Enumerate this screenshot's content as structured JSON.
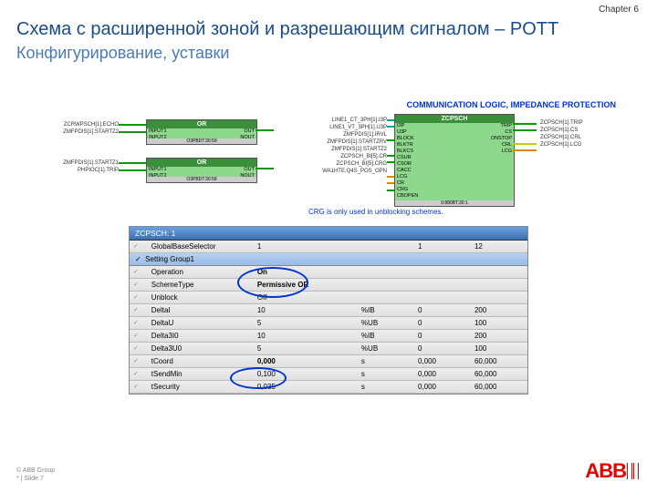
{
  "chapter": "Chapter 6",
  "title1": "Схема с расширенной зоной и разрешающим сигналом – POTT",
  "title2": "Конфигурирование, уставки",
  "diagram_title": "COMMUNICATION LOGIC, IMPEDANCE PROTECTION",
  "or": {
    "header": "OR",
    "in1": "INPUT1",
    "in2": "INPUT2",
    "out": "OUT",
    "nout": "NOUT",
    "foot1": "O3PBDT:30:59",
    "foot2": "O3PBDT:30:58"
  },
  "leftTerms1": [
    "ZCRWPSCH[1].ECHO",
    "ZMFPDIS[1].STARTZ2"
  ],
  "leftTerms2": [
    "ZMFPDIS[1].STARTZ1",
    "PHPIOC[1].TRIP"
  ],
  "midTerms": [
    "LINE1_CT_3PH[1].I3P",
    "LINE1_VT_3PH[1].U3P",
    "",
    "ZMFPDIS[1].IRVL",
    "",
    "ZMFPDIS[1].STARTZRV",
    "ZMFPDIS[1].STARTZ2",
    "",
    "ZCPSCH_BI[5].CR",
    "ZCPSCH_BI[5].CRG",
    "WA1HTE.Q4S_POS_OPN"
  ],
  "main": {
    "header": "ZCPSCH",
    "foot": "0:880BT:30:1",
    "leftPorts": [
      "I3P",
      "U3P",
      "BLOCK",
      "BLKTR",
      "BLKCS",
      "CSUR",
      "CSOR",
      "CACC",
      "LCG",
      "CR",
      "CRG",
      "CBOPEN"
    ],
    "rightPorts": [
      "TRIP",
      "CS",
      "ONSTOP",
      "CRL",
      "LCG"
    ]
  },
  "rightTerms": [
    "ZCPSCH[1].TRIP",
    "ZCPSCH[1].CS",
    "",
    "ZCPSCH[1].CRL",
    "ZCPSCH[1].LCG"
  ],
  "note": "CRG is only used in unblocking schemes.",
  "table": {
    "header": "ZCPSCH: 1",
    "row1": {
      "name": "GlobalBaseSelector",
      "val": "1",
      "unit": "",
      "min": "1",
      "max": "12"
    },
    "section": "Setting Group1",
    "rows": [
      {
        "name": "Operation",
        "val": "On",
        "unit": "",
        "min": "",
        "max": ""
      },
      {
        "name": "SchemeType",
        "val": "Permissive OR",
        "unit": "",
        "min": "",
        "max": ""
      },
      {
        "name": "Unblock",
        "val": "Off",
        "unit": "",
        "min": "",
        "max": ""
      },
      {
        "name": "DeltaI",
        "val": "10",
        "unit": "%IB",
        "min": "0",
        "max": "200"
      },
      {
        "name": "DeltaU",
        "val": "5",
        "unit": "%UB",
        "min": "0",
        "max": "100"
      },
      {
        "name": "Delta3I0",
        "val": "10",
        "unit": "%IB",
        "min": "0",
        "max": "200"
      },
      {
        "name": "Delta3U0",
        "val": "5",
        "unit": "%UB",
        "min": "0",
        "max": "100"
      },
      {
        "name": "tCoord",
        "val": "0,000",
        "unit": "s",
        "min": "0,000",
        "max": "60,000"
      },
      {
        "name": "tSendMin",
        "val": "0,100",
        "unit": "s",
        "min": "0,000",
        "max": "60,000"
      },
      {
        "name": "tSecurity",
        "val": "0,035",
        "unit": "s",
        "min": "0,000",
        "max": "60,000"
      }
    ]
  },
  "footer1": "© ABB Group",
  "footer2": "* | Slide 7",
  "logo": "ABB"
}
